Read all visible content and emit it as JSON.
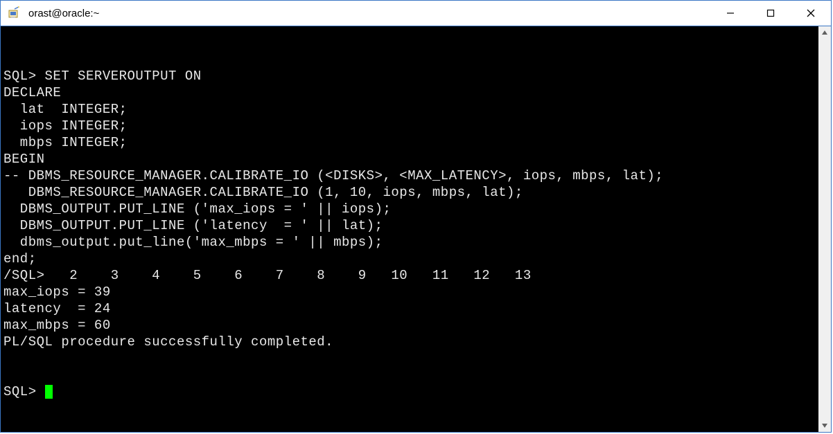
{
  "window": {
    "title": "orast@oracle:~"
  },
  "terminal": {
    "lines": [
      "SQL> SET SERVEROUTPUT ON",
      "DECLARE",
      "  lat  INTEGER;",
      "  iops INTEGER;",
      "  mbps INTEGER;",
      "BEGIN",
      "-- DBMS_RESOURCE_MANAGER.CALIBRATE_IO (<DISKS>, <MAX_LATENCY>, iops, mbps, lat);",
      "   DBMS_RESOURCE_MANAGER.CALIBRATE_IO (1, 10, iops, mbps, lat);",
      "",
      "  DBMS_OUTPUT.PUT_LINE ('max_iops = ' || iops);",
      "  DBMS_OUTPUT.PUT_LINE ('latency  = ' || lat);",
      "  dbms_output.put_line('max_mbps = ' || mbps);",
      "end;",
      "/SQL>   2    3    4    5    6    7    8    9   10   11   12   13",
      "max_iops = 39",
      "latency  = 24",
      "max_mbps = 60",
      "",
      "PL/SQL procedure successfully completed.",
      ""
    ],
    "prompt": "SQL> "
  }
}
